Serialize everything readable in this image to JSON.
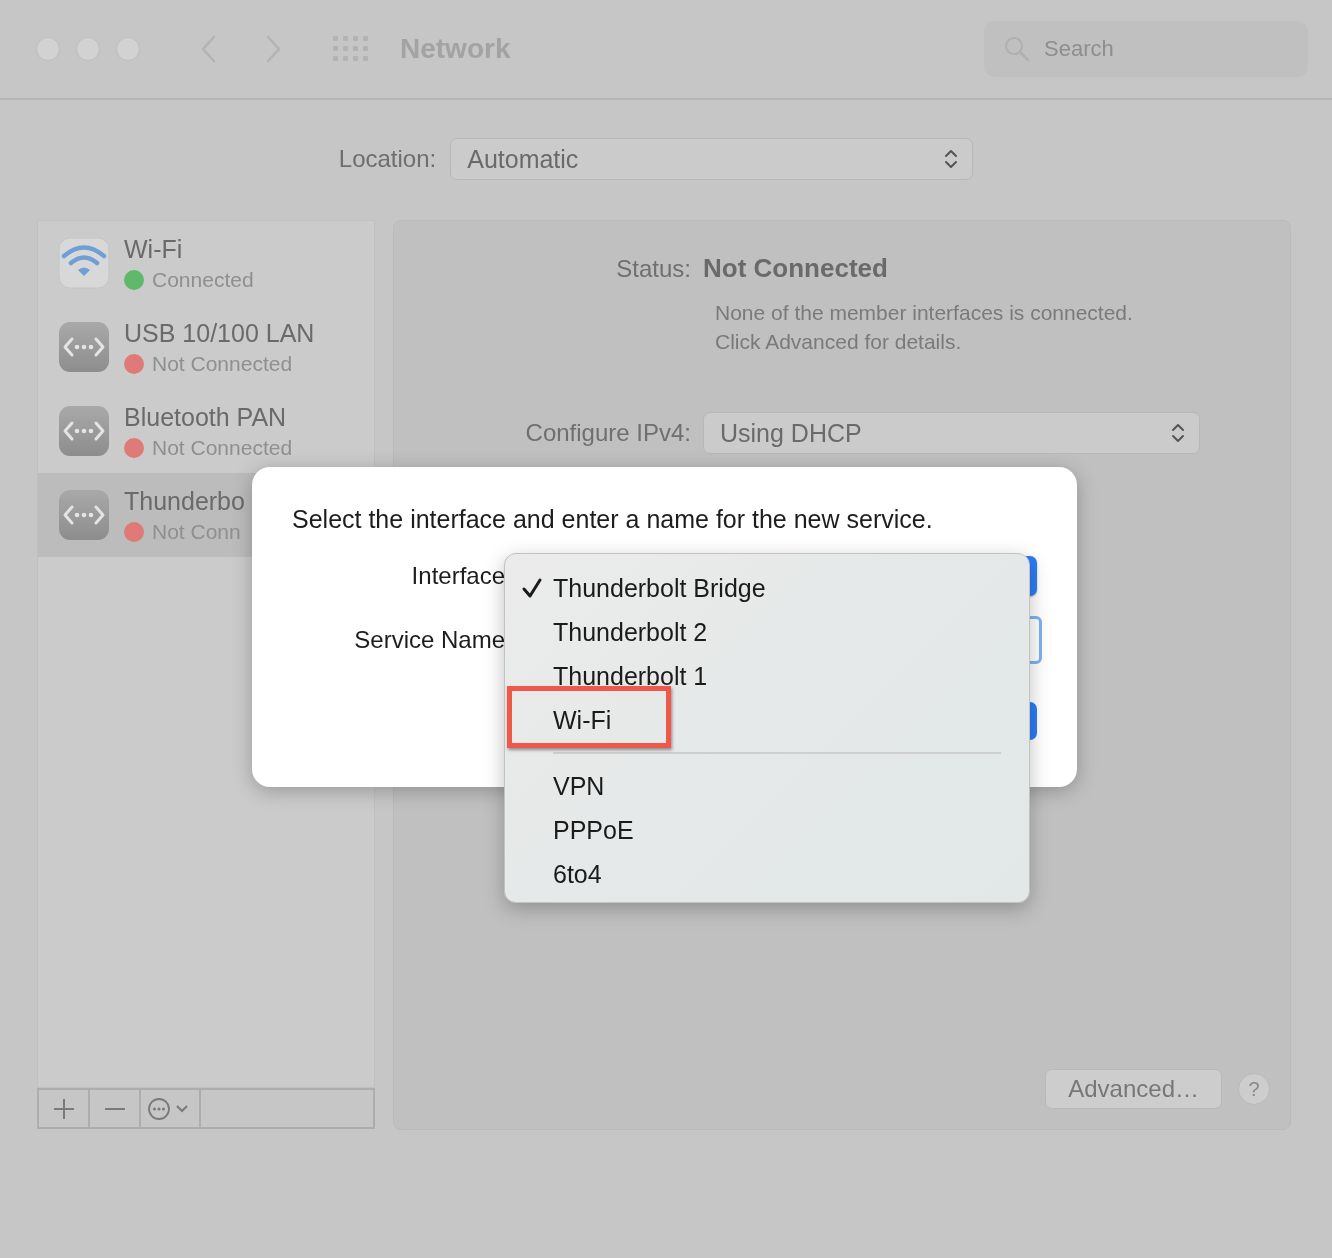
{
  "window": {
    "title": "Network",
    "search": {
      "placeholder": "Search"
    }
  },
  "location": {
    "label": "Location:",
    "value": "Automatic"
  },
  "services": [
    {
      "name": "Wi-Fi",
      "status": "Connected",
      "color": "#5fb96b",
      "kind": "wifi",
      "selected": false
    },
    {
      "name": "USB 10/100 LAN",
      "status": "Not Connected",
      "color": "#e07a78",
      "kind": "ethernet",
      "selected": false
    },
    {
      "name": "Bluetooth PAN",
      "status": "Not Connected",
      "color": "#e07a78",
      "kind": "ethernet",
      "selected": false
    },
    {
      "name": "Thunderbo",
      "status": "Not Conn",
      "color": "#e07a78",
      "kind": "ethernet",
      "selected": true
    }
  ],
  "detail": {
    "status_label": "Status:",
    "status_value": "Not Connected",
    "status_note": [
      "None of the member interfaces is connected.",
      "Click Advanced for details."
    ],
    "configure_label": "Configure IPv4:",
    "configure_value": "Using DHCP",
    "advanced_button": "Advanced…",
    "help_button": "?"
  },
  "dialog": {
    "prompt": "Select the interface and enter a name for the new service.",
    "interface_label": "Interface",
    "service_name_label": "Service Name"
  },
  "menu": {
    "groups": [
      [
        {
          "label": "Thunderbolt Bridge",
          "checked": true,
          "annotated": false
        },
        {
          "label": "Thunderbolt 2",
          "checked": false,
          "annotated": false
        },
        {
          "label": "Thunderbolt 1",
          "checked": false,
          "annotated": false
        },
        {
          "label": "Wi-Fi",
          "checked": false,
          "annotated": true
        }
      ],
      [
        {
          "label": "VPN",
          "checked": false,
          "annotated": false
        },
        {
          "label": "PPPoE",
          "checked": false,
          "annotated": false
        },
        {
          "label": "6to4",
          "checked": false,
          "annotated": false
        }
      ]
    ]
  }
}
